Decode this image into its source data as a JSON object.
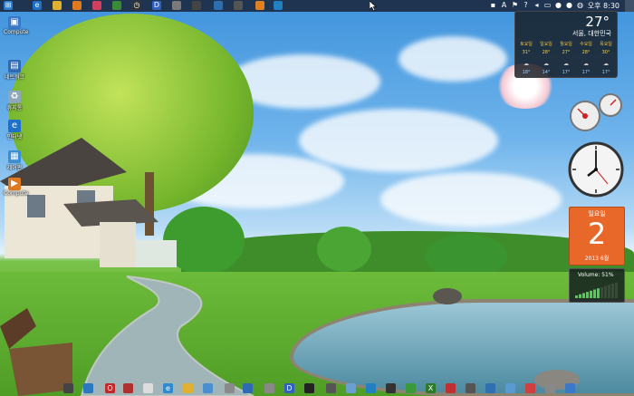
{
  "colors": {
    "sky": "#4a9ce0",
    "grass": "#5aa92e",
    "calendar": "#e8682a"
  },
  "desktop_icons": [
    {
      "label": "Compute",
      "icon": "computer-icon"
    },
    {
      "label": "네트워크",
      "icon": "network-icon"
    },
    {
      "label": "휴지통",
      "icon": "recycle-bin-icon"
    },
    {
      "label": "인터넷",
      "icon": "internet-explorer-icon"
    },
    {
      "label": "제어판",
      "icon": "control-panel-icon"
    },
    {
      "label": "Compute",
      "icon": "windows-media-icon"
    }
  ],
  "top_bar": {
    "clock_time": "오후 8:30",
    "tray_icons": [
      "network-icon",
      "action-center-icon",
      "flag-icon",
      "help-icon",
      "speaker-icon",
      "drive-icon",
      "app-icon",
      "app-icon",
      "globe-icon"
    ]
  },
  "weather": {
    "temperature": "27°",
    "location": "서울, 대한민국",
    "days": [
      {
        "name": "토요일",
        "high": "31°",
        "low": "18°"
      },
      {
        "name": "일요일",
        "high": "28°",
        "low": "14°"
      },
      {
        "name": "월요일",
        "high": "27°",
        "low": "17°"
      },
      {
        "name": "수요일",
        "high": "28°",
        "low": "17°"
      },
      {
        "name": "목요일",
        "high": "30°",
        "low": "17°"
      }
    ]
  },
  "calendar": {
    "weekday": "일요일",
    "day": "2",
    "month_year": "2013 6월"
  },
  "volume": {
    "label": "Volume: 51%",
    "level": 0.51
  }
}
